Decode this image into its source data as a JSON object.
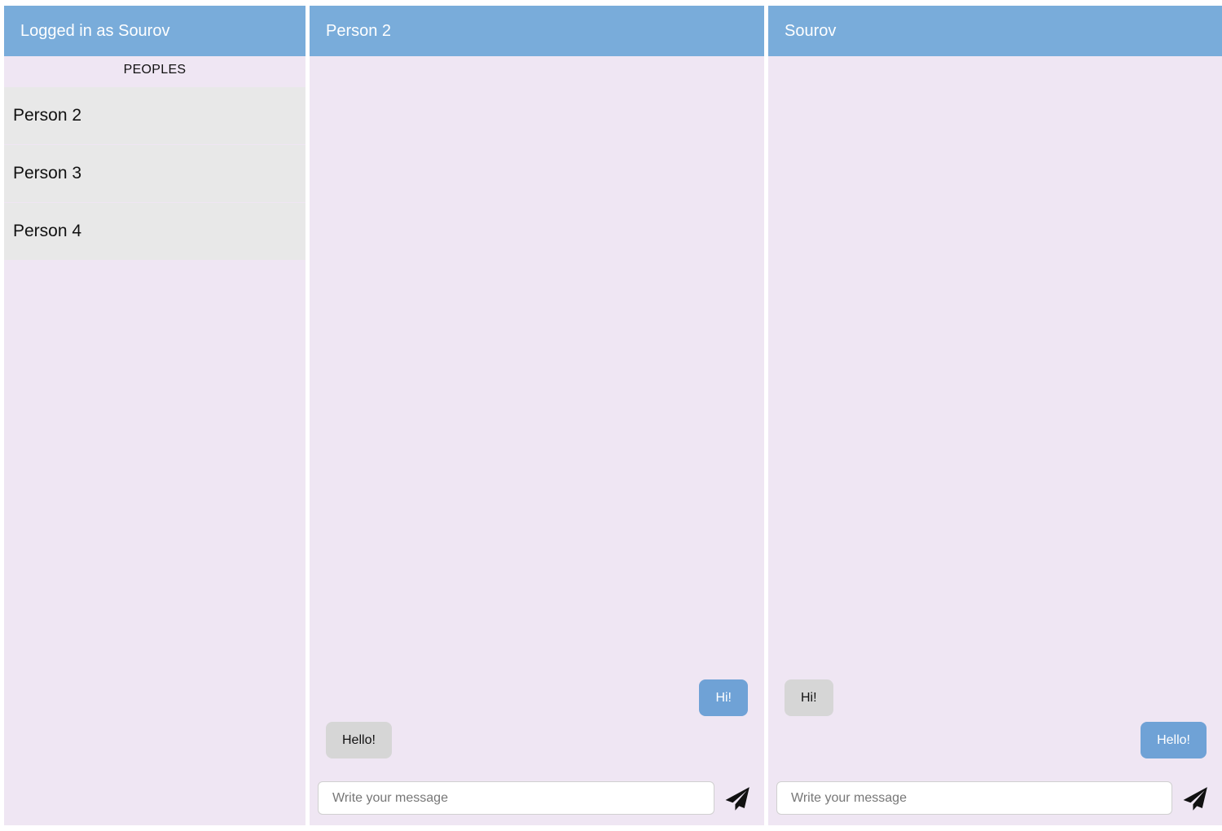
{
  "sidebar": {
    "header": "Logged in as Sourov",
    "heading": "PEOPLES",
    "people": [
      {
        "name": "Person 2"
      },
      {
        "name": "Person 3"
      },
      {
        "name": "Person 4"
      }
    ]
  },
  "chat_a": {
    "title": "Person 2",
    "messages": [
      {
        "text": "Hi!",
        "direction": "sent"
      },
      {
        "text": "Hello!",
        "direction": "received"
      }
    ],
    "input_placeholder": "Write your message",
    "send_icon": "paper-plane-icon"
  },
  "chat_b": {
    "title": "Sourov",
    "messages": [
      {
        "text": "Hi!",
        "direction": "received"
      },
      {
        "text": "Hello!",
        "direction": "sent"
      }
    ],
    "input_placeholder": "Write your message",
    "send_icon": "paper-plane-icon"
  },
  "colors": {
    "header": "#79acda",
    "panel_background": "#efe6f3",
    "sent_bubble": "#6fa2d6",
    "received_bubble": "#d6d6d6",
    "person_item": "#e8e8e8"
  }
}
